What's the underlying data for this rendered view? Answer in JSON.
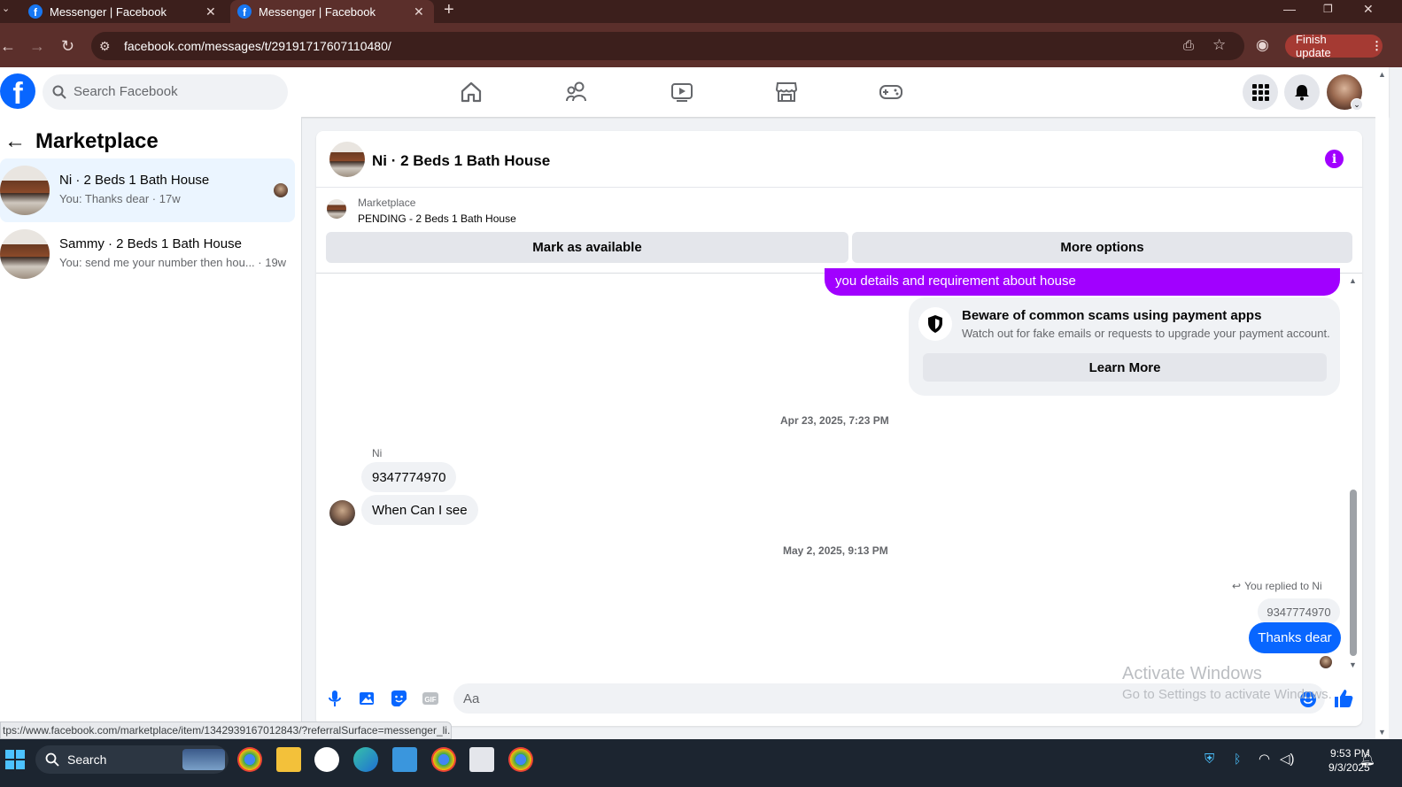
{
  "browser": {
    "tabs": [
      {
        "title": "Messenger | Facebook",
        "active": false
      },
      {
        "title": "Messenger | Facebook",
        "active": true
      }
    ],
    "url": "facebook.com/messages/t/29191717607110480/",
    "finish_update": "Finish update",
    "status_url": "tps://www.facebook.com/marketplace/item/1342939167012843/?referralSurface=messenger_li..."
  },
  "fb": {
    "search_placeholder": "Search Facebook",
    "nav_icons": [
      "home-icon",
      "friends-icon",
      "video-icon",
      "marketplace-icon",
      "gaming-icon"
    ]
  },
  "sidebar": {
    "title": "Marketplace",
    "conversations": [
      {
        "name": "Ni · 2 Beds 1 Bath House",
        "preview": "You: Thanks dear · 17w",
        "active": true
      },
      {
        "name": "Sammy · 2 Beds 1 Bath House",
        "preview": "You: send me your number then hou... · 19w",
        "active": false
      }
    ]
  },
  "chat": {
    "title": "Ni · 2 Beds 1 Bath House",
    "listing_source": "Marketplace",
    "listing_status": "PENDING - 2 Beds 1 Bath House",
    "mark_available": "Mark as available",
    "more_options": "More options",
    "partial_message": "you details and requirement about house",
    "scam_card": {
      "title": "Beware of common scams using payment apps",
      "subtitle": "Watch out for fake emails or requests to upgrade your payment account.",
      "button": "Learn More"
    },
    "timestamp1": "Apr 23, 2025, 7:23 PM",
    "sender": "Ni",
    "incoming": [
      "9347774970",
      "When Can I see"
    ],
    "timestamp2": "May 2, 2025, 9:13 PM",
    "replied_to": "You replied to Ni",
    "quoted": "9347774970",
    "outgoing": "Thanks dear",
    "composer_placeholder": "Aa",
    "colors": {
      "accent_purple": "#a100ff",
      "accent_blue": "#0866ff"
    }
  },
  "watermark": {
    "line1": "Activate Windows",
    "line2": "Go to Settings to activate Windows."
  },
  "taskbar": {
    "search": "Search",
    "time": "9:53 PM",
    "date": "9/3/2025"
  }
}
